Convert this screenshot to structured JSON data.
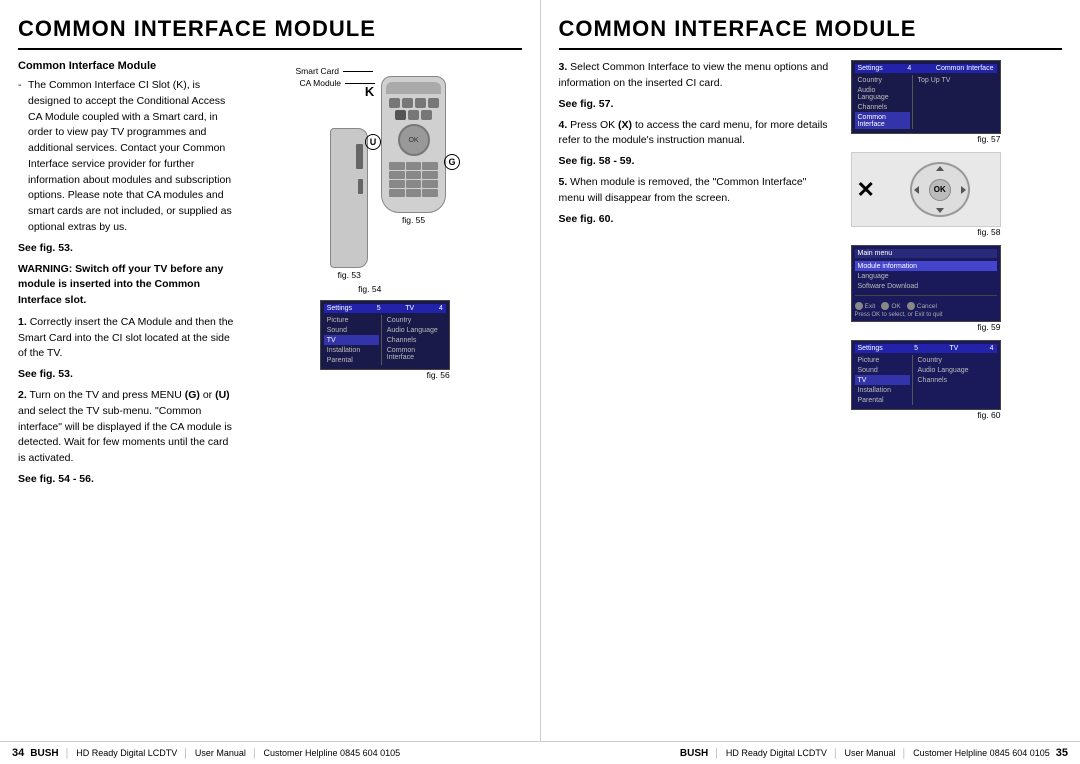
{
  "pages": [
    {
      "title": "COMMON INTERFACE MODULE",
      "page_number": "34",
      "section_heading": "Common Interface Module",
      "body_paragraphs": [
        "The Common Interface CI Slot (K), is designed to accept the Conditional Access CA Module coupled with a Smart card, in order to view pay TV programmes and additional services. Contact your Common Interface service provider for further information about modules and subscription options. Please note that CA modules and smart cards are not included, or supplied as optional extras by us.",
        "See fig. 53."
      ],
      "warning": "WARNING: Switch off your TV before any module is inserted into the Common Interface slot.",
      "steps": [
        {
          "number": "1",
          "text": "Correctly insert the CA Module and then the Smart Card into the CI slot located at the side of the TV.",
          "see_fig": "See fig. 53."
        },
        {
          "number": "2",
          "text": "Turn on the TV and press MENU (G) or (U) and select the TV sub-menu. \"Common interface\" will be displayed if the CA module is detected. Wait for few moments until the card is activated.",
          "see_fig": "See fig. 54 - 56."
        }
      ],
      "smart_card_label": "Smart Card",
      "ca_module_label": "CA Module",
      "fig_labels": [
        "fig. 53",
        "fig. 55",
        "fig. 54",
        "fig. 56"
      ],
      "screen_56": {
        "title_bar": {
          "left": "Settings",
          "middle": "5",
          "right": "TV",
          "right2": "4"
        },
        "left_items": [
          "Picture",
          "Sound",
          "TV",
          "Installation",
          "Parental"
        ],
        "right_items": [
          "Country",
          "Audio Language",
          "Channels",
          "Common Interface"
        ],
        "selected_left": "TV"
      }
    },
    {
      "title": "COMMON INTERFACE MODULE",
      "page_number": "35",
      "steps": [
        {
          "number": "3",
          "text": "Select Common Interface to view the menu options and information on the inserted CI card.",
          "see_fig": "See fig. 57."
        },
        {
          "number": "4",
          "text": "Press OK (X) to access the card menu, for more details refer to the module's instruction manual.",
          "see_fig": "See fig. 58 - 59."
        },
        {
          "number": "5",
          "text": "When module is removed, the \"Common Interface\" menu will disappear from the screen.",
          "see_fig": "See fig. 60."
        }
      ],
      "fig_labels": [
        "fig. 57",
        "fig. 58",
        "fig. 59",
        "fig. 60"
      ],
      "screen_57": {
        "title_bar": {
          "left": "Settings",
          "middle": "4",
          "right": "Common Interface"
        },
        "left_items": [
          "Country",
          "Audio Language",
          "Channels",
          "Common Interface"
        ],
        "right_items": [
          "Top Up TV"
        ],
        "selected_left": "Common Interface"
      },
      "screen_59": {
        "title": "Main menu",
        "items": [
          "Module information",
          "Language",
          "Software Download"
        ],
        "selected": "Module information",
        "footer": "Exit    OK    Cancel",
        "footer_note": "Press OK to select, or Exit to quit"
      },
      "screen_60": {
        "title_bar": {
          "left": "Settings",
          "middle": "5",
          "right": "TV",
          "right2": "4"
        },
        "left_items": [
          "Picture",
          "Sound",
          "TV",
          "Installation",
          "Parental"
        ],
        "right_items": [
          "Country",
          "Audio Language",
          "Channels"
        ],
        "selected_left": "TV"
      }
    }
  ],
  "footer": {
    "brand": "BUSH",
    "product": "HD Ready Digital LCDTV",
    "doc_type": "User Manual",
    "helpline": "Customer Helpline 0845 604 0105"
  }
}
